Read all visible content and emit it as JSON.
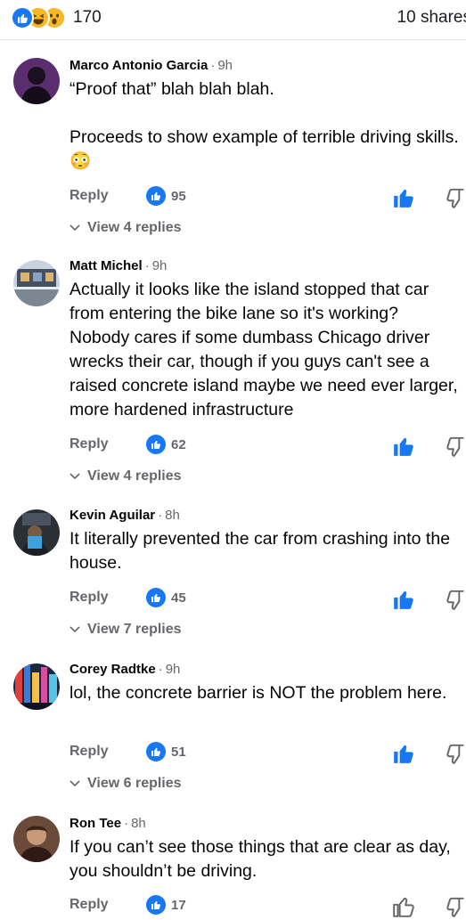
{
  "post_stats": {
    "reactions": [
      "like-icon",
      "haha-icon",
      "wow-icon"
    ],
    "reaction_count": "170",
    "shares": "10 shares"
  },
  "comments": [
    {
      "author": "Marco Antonio Garcia",
      "time": "9h",
      "text": "“Proof that” blah blah blah.\n\nProceeds to show example of terrible driving skills. 😳",
      "reply_label": "Reply",
      "likes": "95",
      "view_replies": "View 4 replies",
      "liked_by_me": true
    },
    {
      "author": "Matt Michel",
      "time": "9h",
      "text": "Actually it looks like the island stopped that car from entering the bike lane so it's working? Nobody cares if some dumbass Chicago driver wrecks their car, though if you guys can't see a raised concrete island maybe we need ever larger, more hardened infrastructure",
      "reply_label": "Reply",
      "likes": "62",
      "view_replies": "View 4 replies",
      "liked_by_me": true
    },
    {
      "author": "Kevin Aguilar",
      "time": "8h",
      "text": "It literally prevented the car from crashing into the house.",
      "reply_label": "Reply",
      "likes": "45",
      "view_replies": "View 7 replies",
      "liked_by_me": true
    },
    {
      "author": "Corey Radtke",
      "time": "9h",
      "text": "lol, the concrete barrier is NOT the problem here.",
      "reply_label": "Reply",
      "likes": "51",
      "view_replies": "View 6 replies",
      "liked_by_me": true
    },
    {
      "author": "Ron Tee",
      "time": "8h",
      "text": "If you can’t see those things that are clear as day, you shouldn’t be driving.",
      "reply_label": "Reply",
      "likes": "17",
      "view_replies": "",
      "liked_by_me": false
    }
  ],
  "colors": {
    "facebook_blue": "#1877f2",
    "meta_text": "#65676b",
    "divider": "#e4e6eb"
  }
}
